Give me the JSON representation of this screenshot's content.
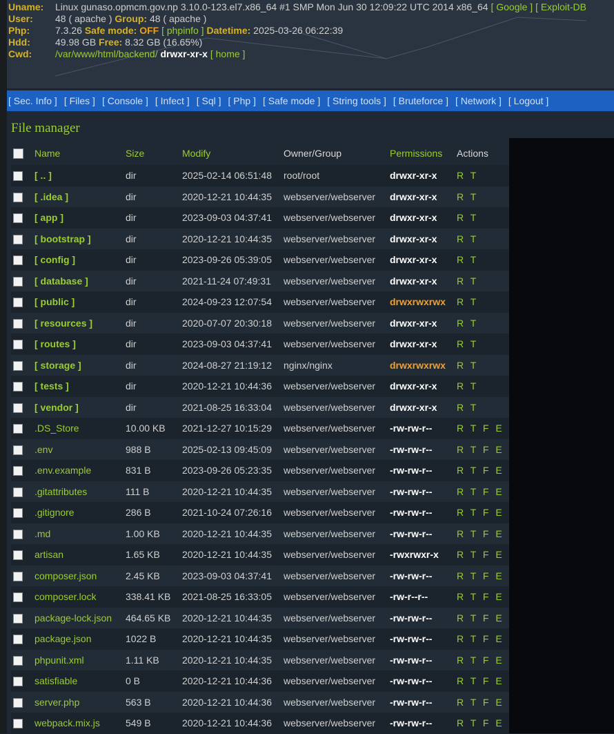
{
  "header": {
    "uname_label": "Uname:",
    "uname_value": "Linux gunaso.opmcm.gov.np 3.10.0-123.el7.x86_64 #1 SMP Mon Jun 30 12:09:22 UTC 2014 x86_64",
    "uname_links": [
      "[ Google ]",
      "[ Exploit-DB"
    ],
    "user_label": "User:",
    "user_value": "48 ( apache )",
    "group_label": "Group:",
    "group_value": "48 ( apache )",
    "php_label": "Php:",
    "php_value": "7.3.26",
    "safe_mode_label": "Safe mode:",
    "safe_mode_value": "OFF",
    "phpinfo_link": "[ phpinfo ]",
    "datetime_label": "Datetime:",
    "datetime_value": "2025-03-26 06:22:39",
    "hdd_label": "Hdd:",
    "hdd_value": "49.98 GB",
    "free_label": "Free:",
    "free_value": "8.32 GB (16.65%)",
    "cwd_label": "Cwd:",
    "cwd_path": "/var/www/html/backend/",
    "cwd_perms": "drwxr-xr-x",
    "home_link": "[ home ]"
  },
  "menu": [
    "[ Sec. Info ]",
    "[ Files ]",
    "[ Console ]",
    "[ Infect ]",
    "[ Sql ]",
    "[ Php ]",
    "[ Safe mode ]",
    "[ String tools ]",
    "[ Bruteforce ]",
    "[ Network ]",
    "[ Logout ]"
  ],
  "file_manager": {
    "title": "File manager",
    "columns": {
      "name": "Name",
      "size": "Size",
      "modify": "Modify",
      "owner": "Owner/Group",
      "permissions": "Permissions",
      "actions": "Actions"
    },
    "rows": [
      {
        "name": "[ .. ]",
        "type": "dir",
        "size": "dir",
        "modify": "2025-02-14 06:51:48",
        "owner": "root/root",
        "perms": "drwxr-xr-x",
        "writable": false,
        "actions": "R T"
      },
      {
        "name": "[ .idea ]",
        "type": "dir",
        "size": "dir",
        "modify": "2020-12-21 10:44:35",
        "owner": "webserver/webserver",
        "perms": "drwxr-xr-x",
        "writable": false,
        "actions": "R T"
      },
      {
        "name": "[ app ]",
        "type": "dir",
        "size": "dir",
        "modify": "2023-09-03 04:37:41",
        "owner": "webserver/webserver",
        "perms": "drwxr-xr-x",
        "writable": false,
        "actions": "R T"
      },
      {
        "name": "[ bootstrap ]",
        "type": "dir",
        "size": "dir",
        "modify": "2020-12-21 10:44:35",
        "owner": "webserver/webserver",
        "perms": "drwxr-xr-x",
        "writable": false,
        "actions": "R T"
      },
      {
        "name": "[ config ]",
        "type": "dir",
        "size": "dir",
        "modify": "2023-09-26 05:39:05",
        "owner": "webserver/webserver",
        "perms": "drwxr-xr-x",
        "writable": false,
        "actions": "R T"
      },
      {
        "name": "[ database ]",
        "type": "dir",
        "size": "dir",
        "modify": "2021-11-24 07:49:31",
        "owner": "webserver/webserver",
        "perms": "drwxr-xr-x",
        "writable": false,
        "actions": "R T"
      },
      {
        "name": "[ public ]",
        "type": "dir",
        "size": "dir",
        "modify": "2024-09-23 12:07:54",
        "owner": "webserver/webserver",
        "perms": "drwxrwxrwx",
        "writable": true,
        "actions": "R T"
      },
      {
        "name": "[ resources ]",
        "type": "dir",
        "size": "dir",
        "modify": "2020-07-07 20:30:18",
        "owner": "webserver/webserver",
        "perms": "drwxr-xr-x",
        "writable": false,
        "actions": "R T"
      },
      {
        "name": "[ routes ]",
        "type": "dir",
        "size": "dir",
        "modify": "2023-09-03 04:37:41",
        "owner": "webserver/webserver",
        "perms": "drwxr-xr-x",
        "writable": false,
        "actions": "R T"
      },
      {
        "name": "[ storage ]",
        "type": "dir",
        "size": "dir",
        "modify": "2024-08-27 21:19:12",
        "owner": "nginx/nginx",
        "perms": "drwxrwxrwx",
        "writable": true,
        "actions": "R T"
      },
      {
        "name": "[ tests ]",
        "type": "dir",
        "size": "dir",
        "modify": "2020-12-21 10:44:36",
        "owner": "webserver/webserver",
        "perms": "drwxr-xr-x",
        "writable": false,
        "actions": "R T"
      },
      {
        "name": "[ vendor ]",
        "type": "dir",
        "size": "dir",
        "modify": "2021-08-25 16:33:04",
        "owner": "webserver/webserver",
        "perms": "drwxr-xr-x",
        "writable": false,
        "actions": "R T"
      },
      {
        "name": ".DS_Store",
        "type": "file",
        "size": "10.00 KB",
        "modify": "2021-12-27 10:15:29",
        "owner": "webserver/webserver",
        "perms": "-rw-rw-r--",
        "writable": false,
        "actions": "R T F E D"
      },
      {
        "name": ".env",
        "type": "file",
        "size": "988 B",
        "modify": "2025-02-13 09:45:09",
        "owner": "webserver/webserver",
        "perms": "-rw-rw-r--",
        "writable": false,
        "actions": "R T F E D"
      },
      {
        "name": ".env.example",
        "type": "file",
        "size": "831 B",
        "modify": "2023-09-26 05:23:35",
        "owner": "webserver/webserver",
        "perms": "-rw-rw-r--",
        "writable": false,
        "actions": "R T F E D"
      },
      {
        "name": ".gitattributes",
        "type": "file",
        "size": "111 B",
        "modify": "2020-12-21 10:44:35",
        "owner": "webserver/webserver",
        "perms": "-rw-rw-r--",
        "writable": false,
        "actions": "R T F E D"
      },
      {
        "name": ".gitignore",
        "type": "file",
        "size": "286 B",
        "modify": "2021-10-24 07:26:16",
        "owner": "webserver/webserver",
        "perms": "-rw-rw-r--",
        "writable": false,
        "actions": "R T F E D"
      },
      {
        "name": ".md",
        "type": "file",
        "size": "1.00 KB",
        "modify": "2020-12-21 10:44:35",
        "owner": "webserver/webserver",
        "perms": "-rw-rw-r--",
        "writable": false,
        "actions": "R T F E D"
      },
      {
        "name": "artisan",
        "type": "file",
        "size": "1.65 KB",
        "modify": "2020-12-21 10:44:35",
        "owner": "webserver/webserver",
        "perms": "-rwxrwxr-x",
        "writable": false,
        "actions": "R T F E D"
      },
      {
        "name": "composer.json",
        "type": "file",
        "size": "2.45 KB",
        "modify": "2023-09-03 04:37:41",
        "owner": "webserver/webserver",
        "perms": "-rw-rw-r--",
        "writable": false,
        "actions": "R T F E D"
      },
      {
        "name": "composer.lock",
        "type": "file",
        "size": "338.41 KB",
        "modify": "2021-08-25 16:33:05",
        "owner": "webserver/webserver",
        "perms": "-rw-r--r--",
        "writable": false,
        "actions": "R T F E D"
      },
      {
        "name": "package-lock.json",
        "type": "file",
        "size": "464.65 KB",
        "modify": "2020-12-21 10:44:35",
        "owner": "webserver/webserver",
        "perms": "-rw-rw-r--",
        "writable": false,
        "actions": "R T F E D"
      },
      {
        "name": "package.json",
        "type": "file",
        "size": "1022 B",
        "modify": "2020-12-21 10:44:35",
        "owner": "webserver/webserver",
        "perms": "-rw-rw-r--",
        "writable": false,
        "actions": "R T F E D"
      },
      {
        "name": "phpunit.xml",
        "type": "file",
        "size": "1.11 KB",
        "modify": "2020-12-21 10:44:35",
        "owner": "webserver/webserver",
        "perms": "-rw-rw-r--",
        "writable": false,
        "actions": "R T F E D"
      },
      {
        "name": "satisfiable",
        "type": "file",
        "size": "0 B",
        "modify": "2020-12-21 10:44:36",
        "owner": "webserver/webserver",
        "perms": "-rw-rw-r--",
        "writable": false,
        "actions": "R T F E D"
      },
      {
        "name": "server.php",
        "type": "file",
        "size": "563 B",
        "modify": "2020-12-21 10:44:36",
        "owner": "webserver/webserver",
        "perms": "-rw-rw-r--",
        "writable": false,
        "actions": "R T F E D"
      },
      {
        "name": "webpack.mix.js",
        "type": "file",
        "size": "549 B",
        "modify": "2020-12-21 10:44:36",
        "owner": "webserver/webserver",
        "perms": "-rw-rw-r--",
        "writable": false,
        "actions": "R T F E D"
      }
    ]
  },
  "colors": {
    "label_gold": "#d4b22a",
    "link_green": "#9acd32",
    "menu_blue": "#1d62c2",
    "writable_orange": "#f0a030",
    "safe_mode_off": "#e8a020"
  }
}
